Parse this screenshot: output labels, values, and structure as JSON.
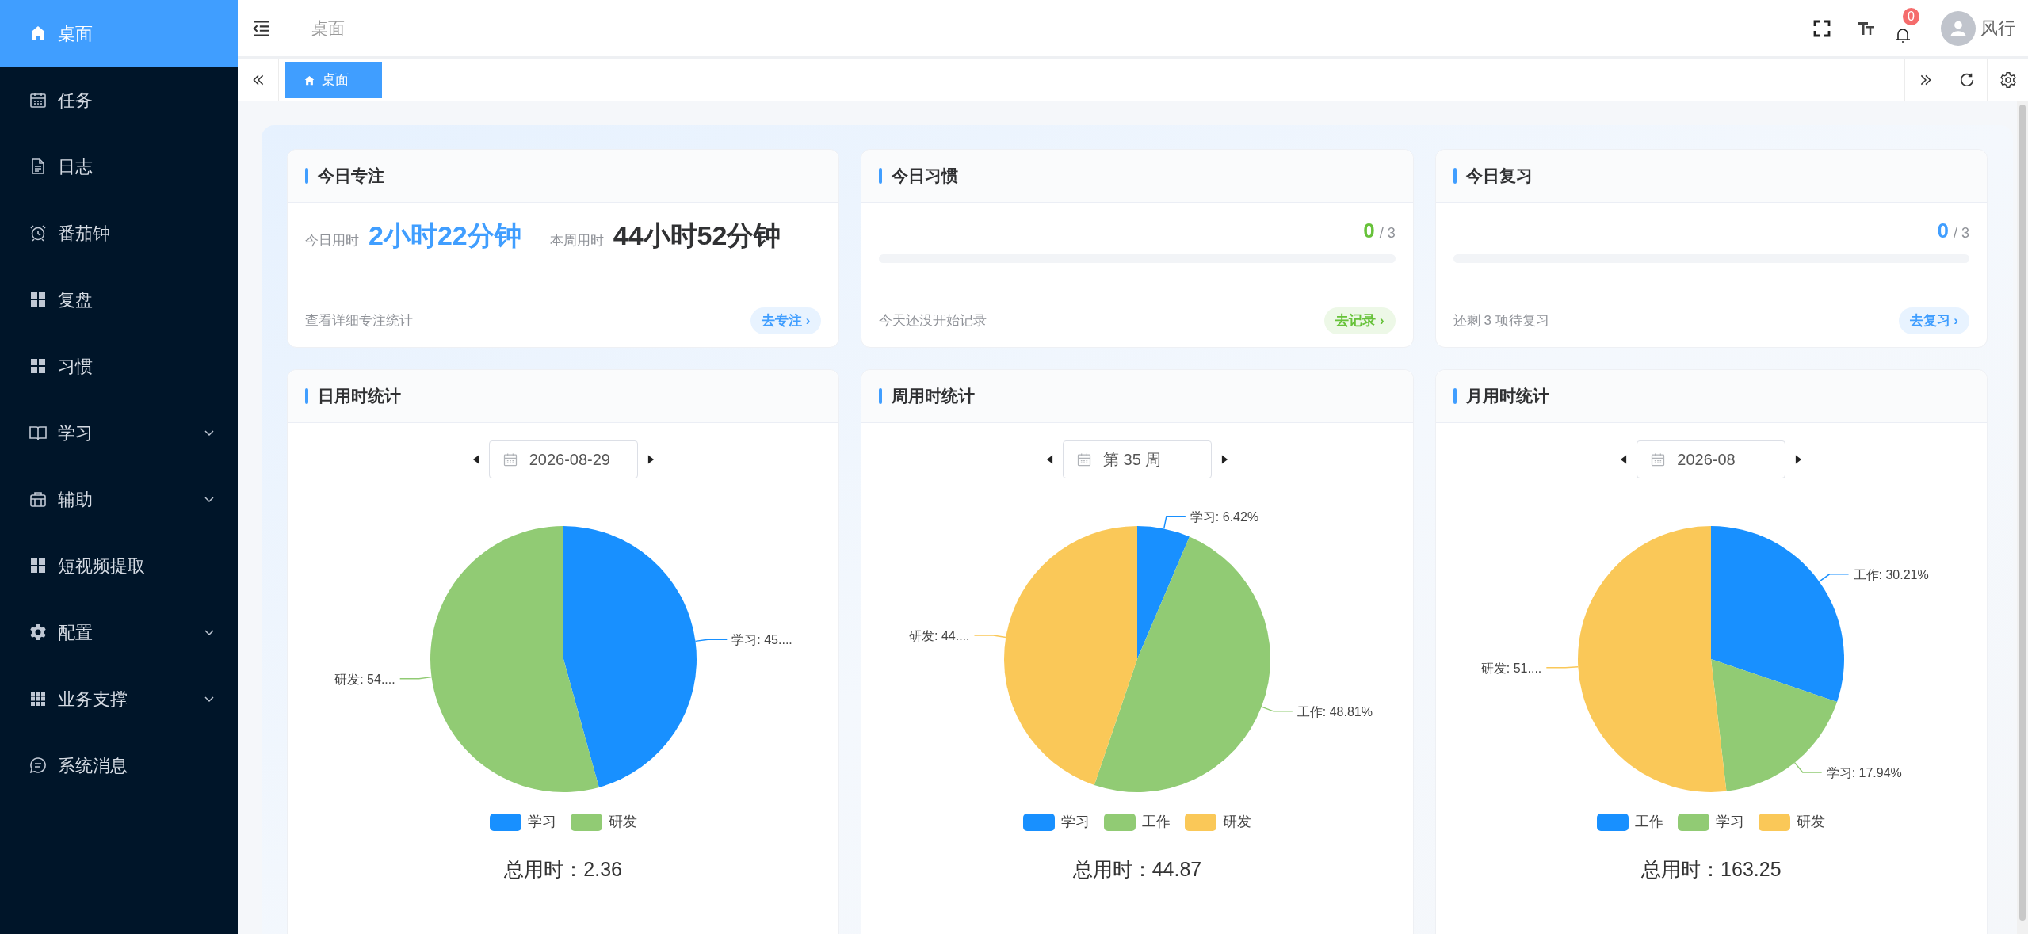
{
  "sidebar": {
    "items": [
      {
        "label": "桌面",
        "kind": "link",
        "selected": true
      },
      {
        "label": "任务",
        "kind": "link",
        "selected": false
      },
      {
        "label": "日志",
        "kind": "link",
        "selected": false
      },
      {
        "label": "番茄钟",
        "kind": "link",
        "selected": false
      },
      {
        "label": "复盘",
        "kind": "link",
        "selected": false
      },
      {
        "label": "习惯",
        "kind": "link",
        "selected": false
      },
      {
        "label": "学习",
        "kind": "group",
        "expanded": false,
        "selected": false
      },
      {
        "label": "辅助",
        "kind": "group",
        "expanded": false,
        "selected": false
      },
      {
        "label": "短视频提取",
        "kind": "link",
        "selected": false
      },
      {
        "label": "配置",
        "kind": "group",
        "expanded": false,
        "selected": false
      },
      {
        "label": "业务支撑",
        "kind": "group",
        "expanded": false,
        "selected": false
      },
      {
        "label": "系统消息",
        "kind": "link",
        "selected": false
      }
    ]
  },
  "header": {
    "breadcrumb": "桌面",
    "notification_count": "0",
    "user_name": "风行"
  },
  "tabs": [
    {
      "label": "桌面",
      "selected": true
    }
  ],
  "summary_cards": [
    {
      "kind": "focus",
      "title": "今日专注",
      "color": "#409eff",
      "stats": [
        {
          "label": "今日用时",
          "value": "2小时22分钟",
          "highlight": true
        },
        {
          "label": "本周用时",
          "value": "44小时52分钟",
          "highlight": false
        }
      ],
      "footer": "查看详细专注统计",
      "action": "去专注 ›"
    },
    {
      "kind": "progress",
      "title": "今日习惯",
      "color": "#67c23a",
      "done": "0",
      "total": "/ 3",
      "level": 0,
      "footer": "今天还没开始记录",
      "action": "去记录 ›"
    },
    {
      "kind": "progress",
      "title": "今日复习",
      "color": "#409eff",
      "done": "0",
      "total": "/ 3",
      "level": 0,
      "footer": "还剩 3 项待复习",
      "action": "去复习 ›"
    }
  ],
  "stat_cards": [
    {
      "title": "日用时统计",
      "period": "2026-08-29",
      "chart_data": {
        "type": "pie",
        "categories": [
          "学习",
          "研发"
        ],
        "values": [
          45.7,
          54.3
        ],
        "value_labels": [
          "学习: 45....",
          "研发: 54...."
        ]
      },
      "legend": [
        {
          "color": "#1890ff"
        },
        {
          "color": "#91cb74"
        }
      ],
      "total": "总用时：2.36"
    },
    {
      "title": "周用时统计",
      "period": "第 35 周",
      "chart_data": {
        "type": "pie",
        "categories": [
          "学习",
          "工作",
          "研发"
        ],
        "values": [
          6.42,
          48.81,
          44.77
        ],
        "value_labels": [
          "学习: 6.42%",
          "工作: 48.81%",
          "研发: 44...."
        ]
      },
      "legend": [
        {
          "color": "#1890ff"
        },
        {
          "color": "#91cb74"
        },
        {
          "color": "#fac858"
        }
      ],
      "total": "总用时：44.87"
    },
    {
      "title": "月用时统计",
      "period": "2026-08",
      "chart_data": {
        "type": "pie",
        "categories": [
          "工作",
          "学习",
          "研发"
        ],
        "values": [
          30.21,
          17.94,
          51.85
        ],
        "value_labels": [
          "工作: 30.21%",
          "学习: 17.94%",
          "研发: 51...."
        ]
      },
      "legend": [
        {
          "color": "#1890ff"
        },
        {
          "color": "#91cb74"
        },
        {
          "color": "#fac858"
        }
      ],
      "total": "总用时：163.25"
    }
  ]
}
